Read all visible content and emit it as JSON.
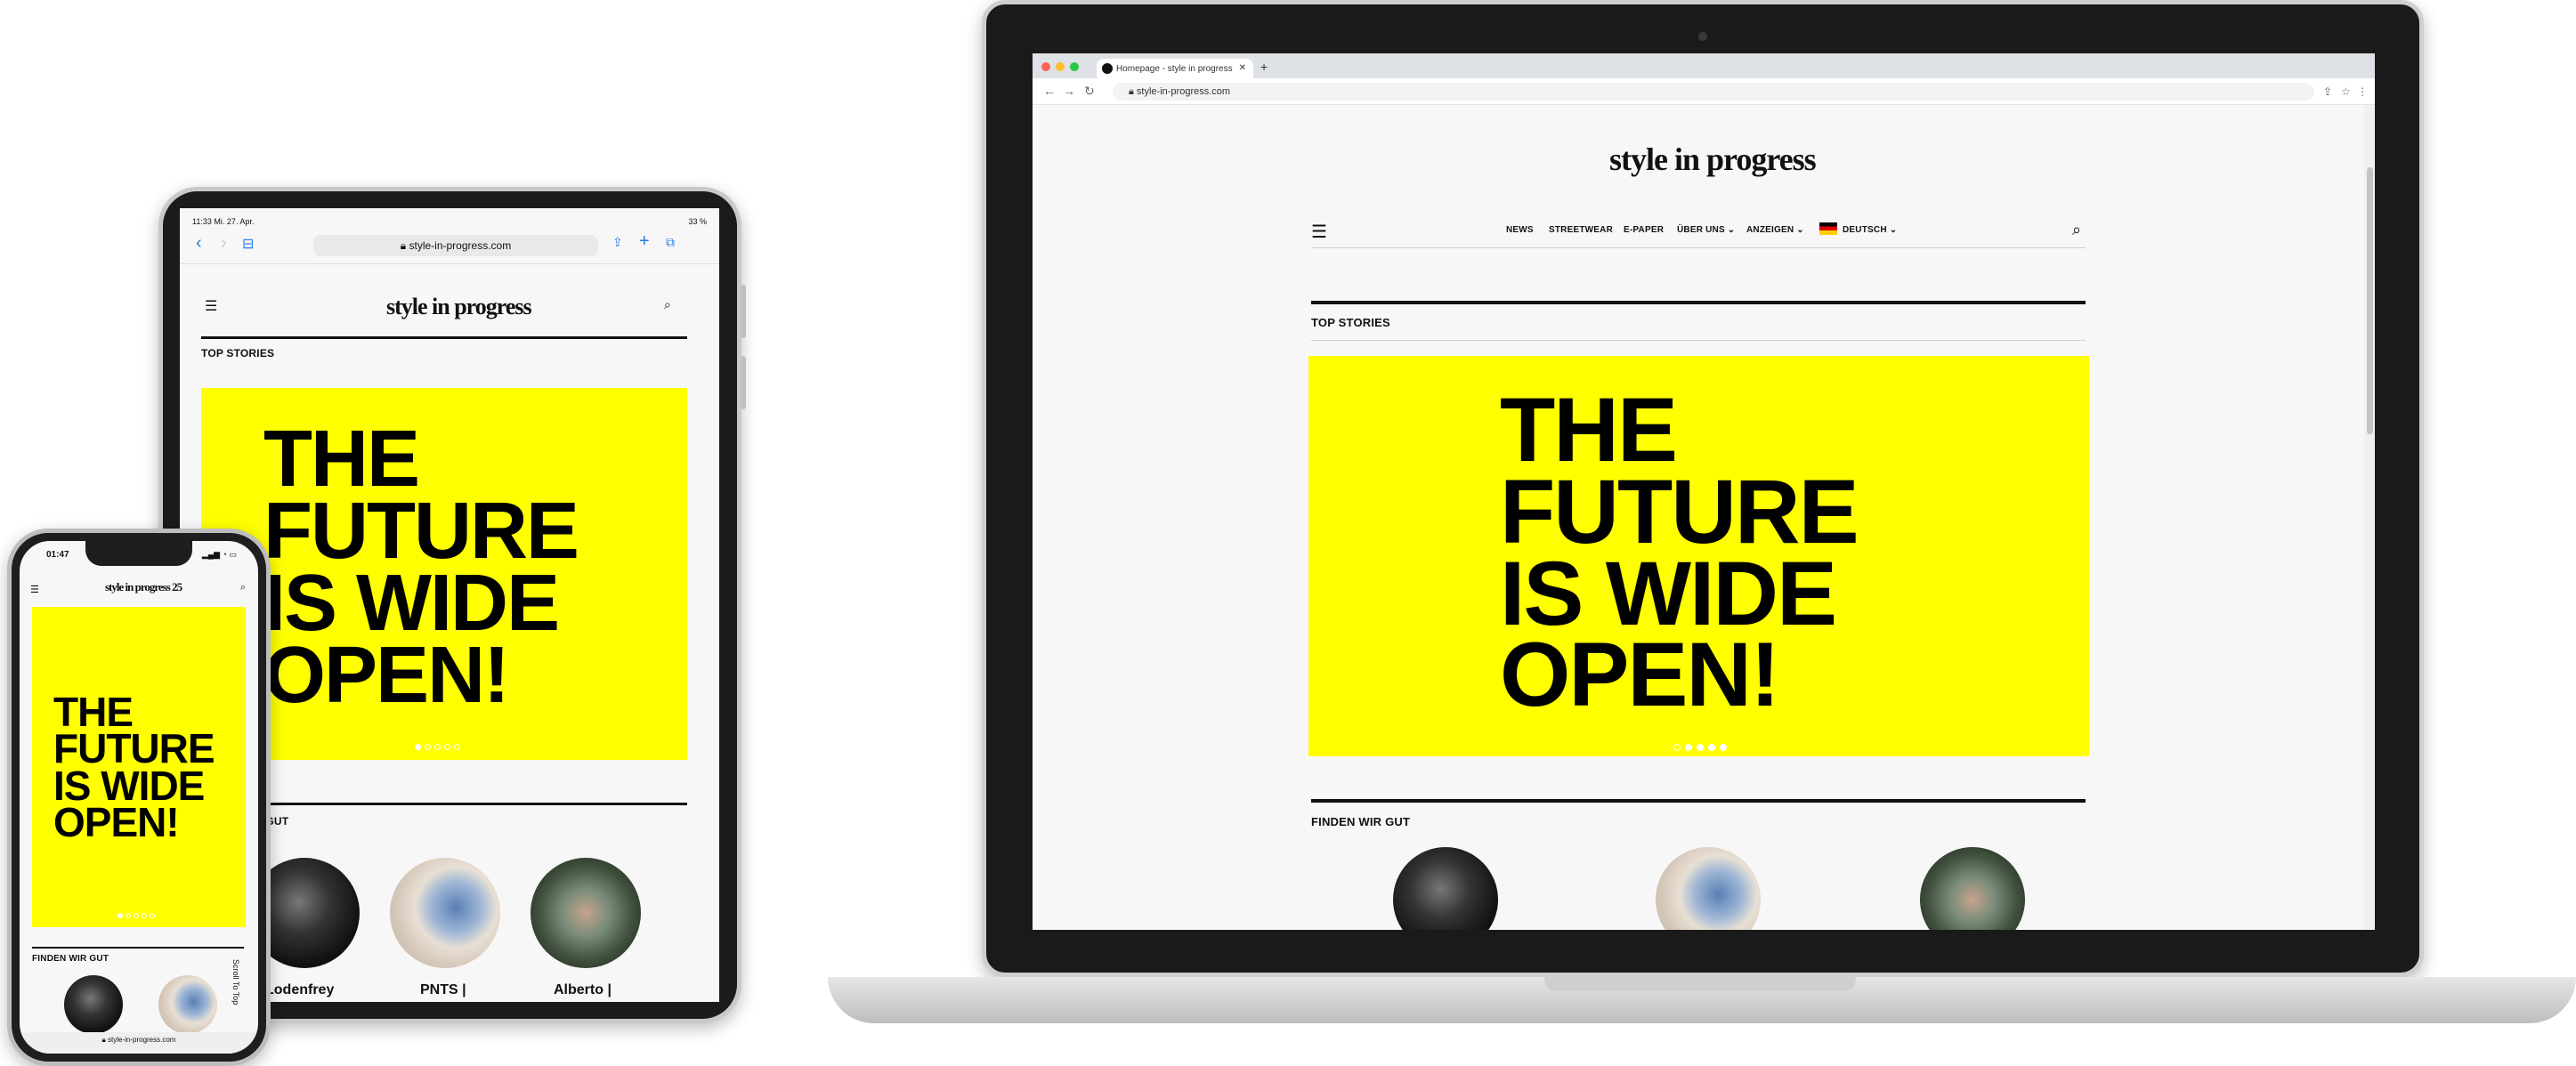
{
  "brand": {
    "logo": "style in progress",
    "yellow": "#FFFF00",
    "black": "#000000"
  },
  "laptop": {
    "tab_title": "Homepage - style in progress",
    "url": "style-in-progress.com",
    "nav": [
      "NEWS",
      "STREETWEAR",
      "E-PAPER",
      "ÜBER UNS ⌄",
      "ANZEIGEN ⌄",
      "DEUTSCH ⌄"
    ],
    "menu_icon": "hamburger-icon",
    "search_icon": "search-icon",
    "section_top": "TOP STORIES",
    "hero_lines": [
      "THE",
      "FUTURE",
      "IS WIDE",
      "OPEN!"
    ],
    "section_finden": "FINDEN WIR GUT"
  },
  "tablet": {
    "status_time": "11:33",
    "status_date": "Mi. 27. Apr.",
    "battery": "33 %",
    "url": "style-in-progress.com",
    "section_top": "TOP STORIES",
    "hero_lines": [
      "THE",
      "FUTURE",
      "IS WIDE",
      "OPEN!"
    ],
    "section_partial": "D GUT",
    "captions": [
      "Lodenfrey",
      "PNTS |",
      "Alberto |"
    ]
  },
  "phone": {
    "status_time": "01:47",
    "logo_suffix": "25",
    "hero_lines": [
      "THE",
      "FUTURE",
      "IS WIDE",
      "OPEN!"
    ],
    "section_finden": "FINDEN WIR GUT",
    "scroll_to_top": "Scroll To Top",
    "url": "style-in-progress.com"
  }
}
